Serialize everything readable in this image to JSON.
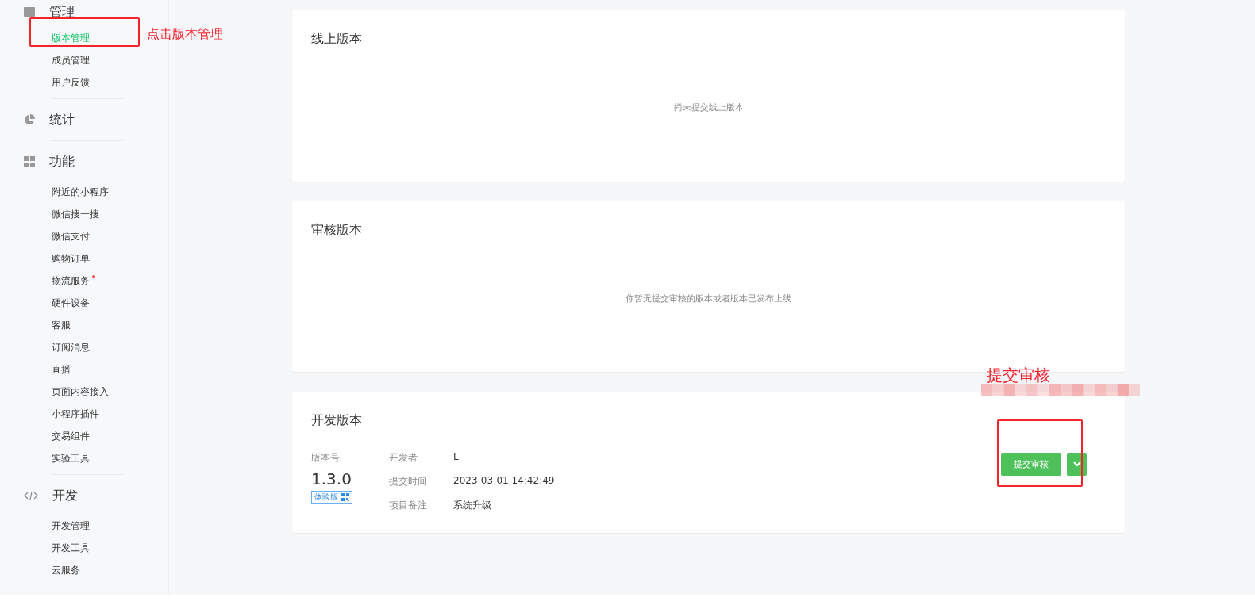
{
  "sidebar": {
    "sections": [
      {
        "title": "管理",
        "kind": "manage",
        "items": [
          {
            "label": "版本管理",
            "selected": true,
            "dot": false
          },
          {
            "label": "成员管理",
            "selected": false,
            "dot": false
          },
          {
            "label": "用户反馈",
            "selected": false,
            "dot": false
          }
        ]
      },
      {
        "title": "统计",
        "kind": "stats"
      },
      {
        "title": "功能",
        "kind": "features",
        "items": [
          {
            "label": "附近的小程序",
            "selected": false,
            "dot": false
          },
          {
            "label": "微信搜一搜",
            "selected": false,
            "dot": false
          },
          {
            "label": "微信支付",
            "selected": false,
            "dot": false
          },
          {
            "label": "购物订单",
            "selected": false,
            "dot": false
          },
          {
            "label": "物流服务",
            "selected": false,
            "dot": true
          },
          {
            "label": "硬件设备",
            "selected": false,
            "dot": false
          },
          {
            "label": "客服",
            "selected": false,
            "dot": false
          },
          {
            "label": "订阅消息",
            "selected": false,
            "dot": false
          },
          {
            "label": "直播",
            "selected": false,
            "dot": false
          },
          {
            "label": "页面内容接入",
            "selected": false,
            "dot": false
          },
          {
            "label": "小程序插件",
            "selected": false,
            "dot": false
          },
          {
            "label": "交易组件",
            "selected": false,
            "dot": false
          },
          {
            "label": "实验工具",
            "selected": false,
            "dot": false
          }
        ]
      },
      {
        "title": "开发",
        "kind": "dev",
        "items": [
          {
            "label": "开发管理",
            "selected": false,
            "dot": false
          },
          {
            "label": "开发工具",
            "selected": false,
            "dot": false
          },
          {
            "label": "云服务",
            "selected": false,
            "dot": false
          }
        ]
      }
    ]
  },
  "online_version": {
    "title": "线上版本",
    "empty_text": "尚未提交线上版本"
  },
  "review_version": {
    "title": "审核版本",
    "empty_text": "你暂无提交审核的版本或者版本已发布上线"
  },
  "dev_version": {
    "title": "开发版本",
    "version_label": "版本号",
    "version": "1.3.0",
    "tag": "体验版",
    "fields": [
      {
        "label": "开发者",
        "value": "L"
      },
      {
        "label": "提交时间",
        "value": "2023-03-01 14:42:49"
      },
      {
        "label": "项目备注",
        "value": "系统升级"
      }
    ],
    "submit_button": "提交审核"
  },
  "annotations": [
    {
      "kind": "sidebar",
      "text": "点击版本管理"
    },
    {
      "kind": "submit",
      "text": "提交审核"
    }
  ]
}
